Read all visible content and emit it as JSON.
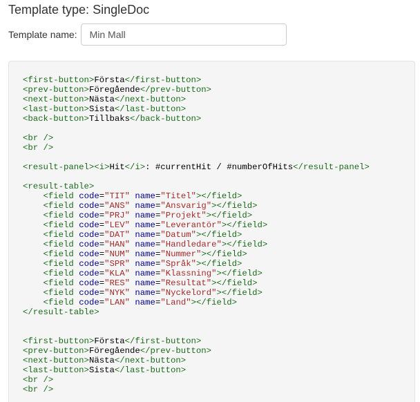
{
  "header": {
    "title": "Template type: SingleDoc"
  },
  "template_name": {
    "label": "Template name:",
    "value": "Min Mall"
  },
  "code_lines": [
    [
      {
        "t": "tag",
        "s": "<first-button>"
      },
      {
        "t": "txt",
        "s": "Första"
      },
      {
        "t": "tag",
        "s": "</first-button>"
      }
    ],
    [
      {
        "t": "tag",
        "s": "<prev-button>"
      },
      {
        "t": "txt",
        "s": "Föregående"
      },
      {
        "t": "tag",
        "s": "</prev-button>"
      }
    ],
    [
      {
        "t": "tag",
        "s": "<next-button>"
      },
      {
        "t": "txt",
        "s": "Nästa"
      },
      {
        "t": "tag",
        "s": "</next-button>"
      }
    ],
    [
      {
        "t": "tag",
        "s": "<last-button>"
      },
      {
        "t": "txt",
        "s": "Sista"
      },
      {
        "t": "tag",
        "s": "</last-button>"
      }
    ],
    [
      {
        "t": "tag",
        "s": "<back-button>"
      },
      {
        "t": "txt",
        "s": "Tillbaks"
      },
      {
        "t": "tag",
        "s": "</back-button>"
      }
    ],
    [],
    [
      {
        "t": "tag",
        "s": "<br />"
      }
    ],
    [
      {
        "t": "tag",
        "s": "<br />"
      }
    ],
    [],
    [
      {
        "t": "tag",
        "s": "<result-panel><i>"
      },
      {
        "t": "txt",
        "s": "Hit"
      },
      {
        "t": "tag",
        "s": "</i>"
      },
      {
        "t": "txt",
        "s": ": #currentHit / #numberOfHits"
      },
      {
        "t": "tag",
        "s": "</result-panel>"
      }
    ],
    [],
    [
      {
        "t": "tag",
        "s": "<result-table>"
      }
    ],
    [
      {
        "t": "txt",
        "s": "    "
      },
      {
        "t": "tag",
        "s": "<field "
      },
      {
        "t": "attr",
        "s": "code"
      },
      {
        "t": "txt",
        "s": "="
      },
      {
        "t": "val",
        "s": "\"TIT\""
      },
      {
        "t": "txt",
        "s": " "
      },
      {
        "t": "attr",
        "s": "name"
      },
      {
        "t": "txt",
        "s": "="
      },
      {
        "t": "val",
        "s": "\"Titel\""
      },
      {
        "t": "tag",
        "s": "></field>"
      }
    ],
    [
      {
        "t": "txt",
        "s": "    "
      },
      {
        "t": "tag",
        "s": "<field "
      },
      {
        "t": "attr",
        "s": "code"
      },
      {
        "t": "txt",
        "s": "="
      },
      {
        "t": "val",
        "s": "\"ANS\""
      },
      {
        "t": "txt",
        "s": " "
      },
      {
        "t": "attr",
        "s": "name"
      },
      {
        "t": "txt",
        "s": "="
      },
      {
        "t": "val",
        "s": "\"Ansvarig\""
      },
      {
        "t": "tag",
        "s": "></field>"
      }
    ],
    [
      {
        "t": "txt",
        "s": "    "
      },
      {
        "t": "tag",
        "s": "<field "
      },
      {
        "t": "attr",
        "s": "code"
      },
      {
        "t": "txt",
        "s": "="
      },
      {
        "t": "val",
        "s": "\"PRJ\""
      },
      {
        "t": "txt",
        "s": " "
      },
      {
        "t": "attr",
        "s": "name"
      },
      {
        "t": "txt",
        "s": "="
      },
      {
        "t": "val",
        "s": "\"Projekt\""
      },
      {
        "t": "tag",
        "s": "></field>"
      }
    ],
    [
      {
        "t": "txt",
        "s": "    "
      },
      {
        "t": "tag",
        "s": "<field "
      },
      {
        "t": "attr",
        "s": "code"
      },
      {
        "t": "txt",
        "s": "="
      },
      {
        "t": "val",
        "s": "\"LEV\""
      },
      {
        "t": "txt",
        "s": " "
      },
      {
        "t": "attr",
        "s": "name"
      },
      {
        "t": "txt",
        "s": "="
      },
      {
        "t": "val",
        "s": "\"Leverantör\""
      },
      {
        "t": "tag",
        "s": "></field>"
      }
    ],
    [
      {
        "t": "txt",
        "s": "    "
      },
      {
        "t": "tag",
        "s": "<field "
      },
      {
        "t": "attr",
        "s": "code"
      },
      {
        "t": "txt",
        "s": "="
      },
      {
        "t": "val",
        "s": "\"DAT\""
      },
      {
        "t": "txt",
        "s": " "
      },
      {
        "t": "attr",
        "s": "name"
      },
      {
        "t": "txt",
        "s": "="
      },
      {
        "t": "val",
        "s": "\"Datum\""
      },
      {
        "t": "tag",
        "s": "></field>"
      }
    ],
    [
      {
        "t": "txt",
        "s": "    "
      },
      {
        "t": "tag",
        "s": "<field "
      },
      {
        "t": "attr",
        "s": "code"
      },
      {
        "t": "txt",
        "s": "="
      },
      {
        "t": "val",
        "s": "\"HAN\""
      },
      {
        "t": "txt",
        "s": " "
      },
      {
        "t": "attr",
        "s": "name"
      },
      {
        "t": "txt",
        "s": "="
      },
      {
        "t": "val",
        "s": "\"Handledare\""
      },
      {
        "t": "tag",
        "s": "></field>"
      }
    ],
    [
      {
        "t": "txt",
        "s": "    "
      },
      {
        "t": "tag",
        "s": "<field "
      },
      {
        "t": "attr",
        "s": "code"
      },
      {
        "t": "txt",
        "s": "="
      },
      {
        "t": "val",
        "s": "\"NUM\""
      },
      {
        "t": "txt",
        "s": " "
      },
      {
        "t": "attr",
        "s": "name"
      },
      {
        "t": "txt",
        "s": "="
      },
      {
        "t": "val",
        "s": "\"Nummer\""
      },
      {
        "t": "tag",
        "s": "></field>"
      }
    ],
    [
      {
        "t": "txt",
        "s": "    "
      },
      {
        "t": "tag",
        "s": "<field "
      },
      {
        "t": "attr",
        "s": "code"
      },
      {
        "t": "txt",
        "s": "="
      },
      {
        "t": "val",
        "s": "\"SPR\""
      },
      {
        "t": "txt",
        "s": " "
      },
      {
        "t": "attr",
        "s": "name"
      },
      {
        "t": "txt",
        "s": "="
      },
      {
        "t": "val",
        "s": "\"Språk\""
      },
      {
        "t": "tag",
        "s": "></field>"
      }
    ],
    [
      {
        "t": "txt",
        "s": "    "
      },
      {
        "t": "tag",
        "s": "<field "
      },
      {
        "t": "attr",
        "s": "code"
      },
      {
        "t": "txt",
        "s": "="
      },
      {
        "t": "val",
        "s": "\"KLA\""
      },
      {
        "t": "txt",
        "s": " "
      },
      {
        "t": "attr",
        "s": "name"
      },
      {
        "t": "txt",
        "s": "="
      },
      {
        "t": "val",
        "s": "\"Klassning\""
      },
      {
        "t": "tag",
        "s": "></field>"
      }
    ],
    [
      {
        "t": "txt",
        "s": "    "
      },
      {
        "t": "tag",
        "s": "<field "
      },
      {
        "t": "attr",
        "s": "code"
      },
      {
        "t": "txt",
        "s": "="
      },
      {
        "t": "val",
        "s": "\"RES\""
      },
      {
        "t": "txt",
        "s": " "
      },
      {
        "t": "attr",
        "s": "name"
      },
      {
        "t": "txt",
        "s": "="
      },
      {
        "t": "val",
        "s": "\"Resultat\""
      },
      {
        "t": "tag",
        "s": "></field>"
      }
    ],
    [
      {
        "t": "txt",
        "s": "    "
      },
      {
        "t": "tag",
        "s": "<field "
      },
      {
        "t": "attr",
        "s": "code"
      },
      {
        "t": "txt",
        "s": "="
      },
      {
        "t": "val",
        "s": "\"NYK\""
      },
      {
        "t": "txt",
        "s": " "
      },
      {
        "t": "attr",
        "s": "name"
      },
      {
        "t": "txt",
        "s": "="
      },
      {
        "t": "val",
        "s": "\"Nyckelord\""
      },
      {
        "t": "tag",
        "s": "></field>"
      }
    ],
    [
      {
        "t": "txt",
        "s": "    "
      },
      {
        "t": "tag",
        "s": "<field "
      },
      {
        "t": "attr",
        "s": "code"
      },
      {
        "t": "txt",
        "s": "="
      },
      {
        "t": "val",
        "s": "\"LAN\""
      },
      {
        "t": "txt",
        "s": " "
      },
      {
        "t": "attr",
        "s": "name"
      },
      {
        "t": "txt",
        "s": "="
      },
      {
        "t": "val",
        "s": "\"Land\""
      },
      {
        "t": "tag",
        "s": "></field>"
      }
    ],
    [
      {
        "t": "tag",
        "s": "</result-table>"
      }
    ],
    [],
    [],
    [
      {
        "t": "tag",
        "s": "<first-button>"
      },
      {
        "t": "txt",
        "s": "Första"
      },
      {
        "t": "tag",
        "s": "</first-button>"
      }
    ],
    [
      {
        "t": "tag",
        "s": "<prev-button>"
      },
      {
        "t": "txt",
        "s": "Föregående"
      },
      {
        "t": "tag",
        "s": "</prev-button>"
      }
    ],
    [
      {
        "t": "tag",
        "s": "<next-button>"
      },
      {
        "t": "txt",
        "s": "Nästa"
      },
      {
        "t": "tag",
        "s": "</next-button>"
      }
    ],
    [
      {
        "t": "tag",
        "s": "<last-button>"
      },
      {
        "t": "txt",
        "s": "Sista"
      },
      {
        "t": "tag",
        "s": "</last-button>"
      }
    ],
    [
      {
        "t": "tag",
        "s": "<br />"
      }
    ],
    [
      {
        "t": "tag",
        "s": "<br />"
      }
    ]
  ]
}
